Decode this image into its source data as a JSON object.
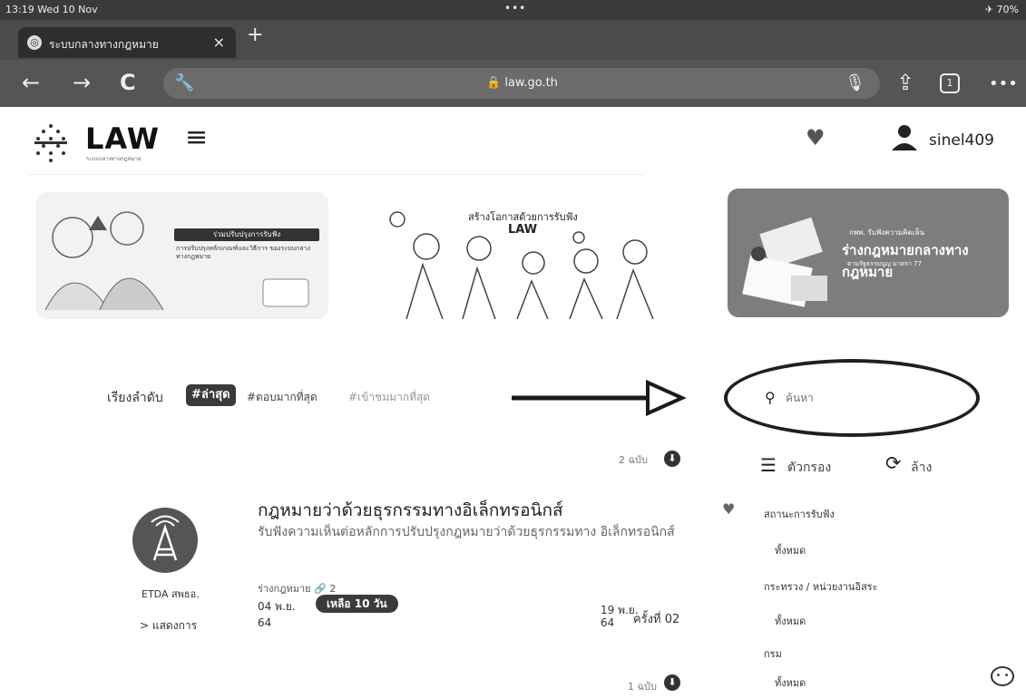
{
  "status_bar": {
    "time": "13:19  Wed 10 Nov",
    "dots": "•••",
    "battery": "✈ 70%"
  },
  "browser": {
    "tab_title": "ระบบกลางทางกฎหมาย",
    "tab_close": "×",
    "new_tab": "+",
    "back": "←",
    "forward": "→",
    "reload": "C",
    "url": "🔒 law.go.th",
    "share": "⇪",
    "tabs_count": "1",
    "more": "•••"
  },
  "header": {
    "logo_text": "LAW",
    "logo_sub": "ระบบกลางทางกฎหมาย",
    "menu": "≡",
    "favorite": "♥",
    "username": "sinel409"
  },
  "banners": {
    "b1_label": "ร่วมปรับปรุงการรับฟัง",
    "b1_lines": "การปรับปรุงหลักเกณฑ์และวิธีการ ของระบบกลางทางกฎหมาย",
    "b2_title": "สร้างโอกาสด้วยการรับฟัง",
    "b2_logo": "LAW",
    "b3_head": "กพพ. รับฟังความคิดเห็น",
    "b3_big": "ร่างกฎหมายกลางทางกฎหมาย",
    "b3_sub": "ตามรัฐธรรมนูญ มาตรา 77"
  },
  "sort": {
    "label": "เรียงลำดับ",
    "active": "#ล่าสุด",
    "option_2": "#ตอบมากที่สุด",
    "option_3": "#เข้าชมมากที่สุด"
  },
  "search": {
    "icon": "🔍",
    "placeholder": "ค้นหา"
  },
  "feed": {
    "count_top": "2 ฉบับ",
    "download_glyph": "⬇",
    "count_bottom": "1 ฉบับ",
    "item": {
      "title": "กฎหมายว่าด้วยธุรกรรมทางอิเล็กทรอนิกส์",
      "description": "รับฟังความเห็นต่อหลักการปรับปรุงกฎหมายว่าด้วยธุรกรรมทาง อิเล็กทรอนิกส์",
      "meta": "ร่างกฎหมาย  🔗 2",
      "date_start": "04 พ.ย.",
      "remaining": "เหลือ 10 วัน",
      "year_start": "64",
      "date_end": "19 พ.ย.",
      "year_end": "64",
      "round": "ครั้งที่  02",
      "org": "ETDA สพธอ.",
      "org_action": "> แสดงการ",
      "logo_glyph": "📡"
    }
  },
  "filters": {
    "filter_label": "ตัวกรอง",
    "clear_label": "ล้าง",
    "status_title": "สถานะการรับฟัง",
    "status_value": "ทั้งหมด",
    "agency_title": "กระทรวง / หน่วยงานอิสระ",
    "agency_value": "ทั้งหมด",
    "dept_title": "กรม",
    "dept_value": "ทั้งหมด"
  }
}
